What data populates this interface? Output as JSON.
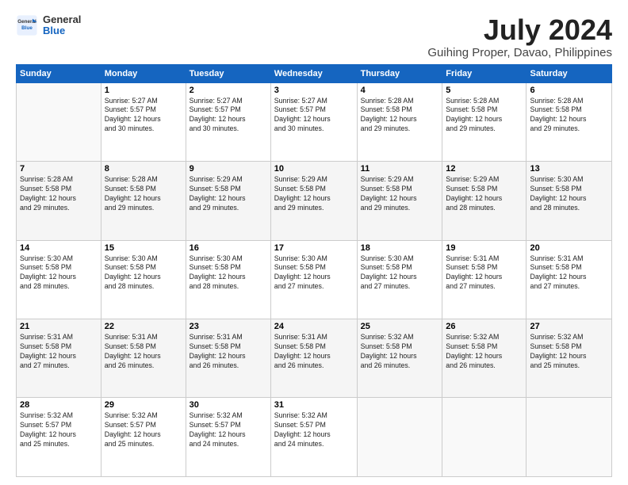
{
  "header": {
    "logo_general": "General",
    "logo_blue": "Blue",
    "title": "July 2024",
    "subtitle": "Guihing Proper, Davao, Philippines"
  },
  "weekdays": [
    "Sunday",
    "Monday",
    "Tuesday",
    "Wednesday",
    "Thursday",
    "Friday",
    "Saturday"
  ],
  "weeks": [
    [
      {
        "day": "",
        "info": ""
      },
      {
        "day": "1",
        "info": "Sunrise: 5:27 AM\nSunset: 5:57 PM\nDaylight: 12 hours\nand 30 minutes."
      },
      {
        "day": "2",
        "info": "Sunrise: 5:27 AM\nSunset: 5:57 PM\nDaylight: 12 hours\nand 30 minutes."
      },
      {
        "day": "3",
        "info": "Sunrise: 5:27 AM\nSunset: 5:57 PM\nDaylight: 12 hours\nand 30 minutes."
      },
      {
        "day": "4",
        "info": "Sunrise: 5:28 AM\nSunset: 5:58 PM\nDaylight: 12 hours\nand 29 minutes."
      },
      {
        "day": "5",
        "info": "Sunrise: 5:28 AM\nSunset: 5:58 PM\nDaylight: 12 hours\nand 29 minutes."
      },
      {
        "day": "6",
        "info": "Sunrise: 5:28 AM\nSunset: 5:58 PM\nDaylight: 12 hours\nand 29 minutes."
      }
    ],
    [
      {
        "day": "7",
        "info": "Sunrise: 5:28 AM\nSunset: 5:58 PM\nDaylight: 12 hours\nand 29 minutes."
      },
      {
        "day": "8",
        "info": "Sunrise: 5:28 AM\nSunset: 5:58 PM\nDaylight: 12 hours\nand 29 minutes."
      },
      {
        "day": "9",
        "info": "Sunrise: 5:29 AM\nSunset: 5:58 PM\nDaylight: 12 hours\nand 29 minutes."
      },
      {
        "day": "10",
        "info": "Sunrise: 5:29 AM\nSunset: 5:58 PM\nDaylight: 12 hours\nand 29 minutes."
      },
      {
        "day": "11",
        "info": "Sunrise: 5:29 AM\nSunset: 5:58 PM\nDaylight: 12 hours\nand 29 minutes."
      },
      {
        "day": "12",
        "info": "Sunrise: 5:29 AM\nSunset: 5:58 PM\nDaylight: 12 hours\nand 28 minutes."
      },
      {
        "day": "13",
        "info": "Sunrise: 5:30 AM\nSunset: 5:58 PM\nDaylight: 12 hours\nand 28 minutes."
      }
    ],
    [
      {
        "day": "14",
        "info": "Sunrise: 5:30 AM\nSunset: 5:58 PM\nDaylight: 12 hours\nand 28 minutes."
      },
      {
        "day": "15",
        "info": "Sunrise: 5:30 AM\nSunset: 5:58 PM\nDaylight: 12 hours\nand 28 minutes."
      },
      {
        "day": "16",
        "info": "Sunrise: 5:30 AM\nSunset: 5:58 PM\nDaylight: 12 hours\nand 28 minutes."
      },
      {
        "day": "17",
        "info": "Sunrise: 5:30 AM\nSunset: 5:58 PM\nDaylight: 12 hours\nand 27 minutes."
      },
      {
        "day": "18",
        "info": "Sunrise: 5:30 AM\nSunset: 5:58 PM\nDaylight: 12 hours\nand 27 minutes."
      },
      {
        "day": "19",
        "info": "Sunrise: 5:31 AM\nSunset: 5:58 PM\nDaylight: 12 hours\nand 27 minutes."
      },
      {
        "day": "20",
        "info": "Sunrise: 5:31 AM\nSunset: 5:58 PM\nDaylight: 12 hours\nand 27 minutes."
      }
    ],
    [
      {
        "day": "21",
        "info": "Sunrise: 5:31 AM\nSunset: 5:58 PM\nDaylight: 12 hours\nand 27 minutes."
      },
      {
        "day": "22",
        "info": "Sunrise: 5:31 AM\nSunset: 5:58 PM\nDaylight: 12 hours\nand 26 minutes."
      },
      {
        "day": "23",
        "info": "Sunrise: 5:31 AM\nSunset: 5:58 PM\nDaylight: 12 hours\nand 26 minutes."
      },
      {
        "day": "24",
        "info": "Sunrise: 5:31 AM\nSunset: 5:58 PM\nDaylight: 12 hours\nand 26 minutes."
      },
      {
        "day": "25",
        "info": "Sunrise: 5:32 AM\nSunset: 5:58 PM\nDaylight: 12 hours\nand 26 minutes."
      },
      {
        "day": "26",
        "info": "Sunrise: 5:32 AM\nSunset: 5:58 PM\nDaylight: 12 hours\nand 26 minutes."
      },
      {
        "day": "27",
        "info": "Sunrise: 5:32 AM\nSunset: 5:58 PM\nDaylight: 12 hours\nand 25 minutes."
      }
    ],
    [
      {
        "day": "28",
        "info": "Sunrise: 5:32 AM\nSunset: 5:57 PM\nDaylight: 12 hours\nand 25 minutes."
      },
      {
        "day": "29",
        "info": "Sunrise: 5:32 AM\nSunset: 5:57 PM\nDaylight: 12 hours\nand 25 minutes."
      },
      {
        "day": "30",
        "info": "Sunrise: 5:32 AM\nSunset: 5:57 PM\nDaylight: 12 hours\nand 24 minutes."
      },
      {
        "day": "31",
        "info": "Sunrise: 5:32 AM\nSunset: 5:57 PM\nDaylight: 12 hours\nand 24 minutes."
      },
      {
        "day": "",
        "info": ""
      },
      {
        "day": "",
        "info": ""
      },
      {
        "day": "",
        "info": ""
      }
    ]
  ]
}
